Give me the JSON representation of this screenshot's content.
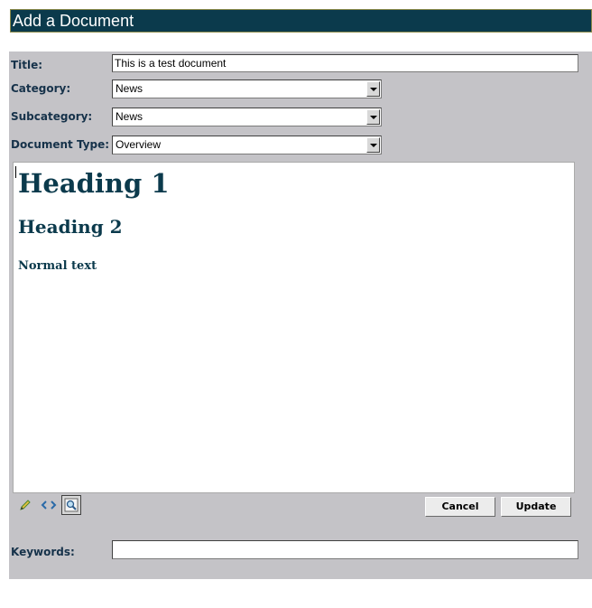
{
  "header": {
    "title": "Add a Document"
  },
  "form": {
    "title_label": "Title:",
    "title_value": "This is a test document",
    "category_label": "Category:",
    "category_value": "News",
    "subcategory_label": "Subcategory:",
    "subcategory_value": "News",
    "doctype_label": "Document Type:",
    "doctype_value": "Overview",
    "keywords_label": "Keywords:",
    "keywords_value": ""
  },
  "editor": {
    "heading1": "Heading 1",
    "heading2": "Heading 2",
    "normal": "Normal text"
  },
  "toolbar": {
    "modes": [
      "pencil-icon",
      "code-icon",
      "preview-icon"
    ],
    "active_mode": "preview-icon",
    "cancel_label": "Cancel",
    "update_label": "Update"
  }
}
